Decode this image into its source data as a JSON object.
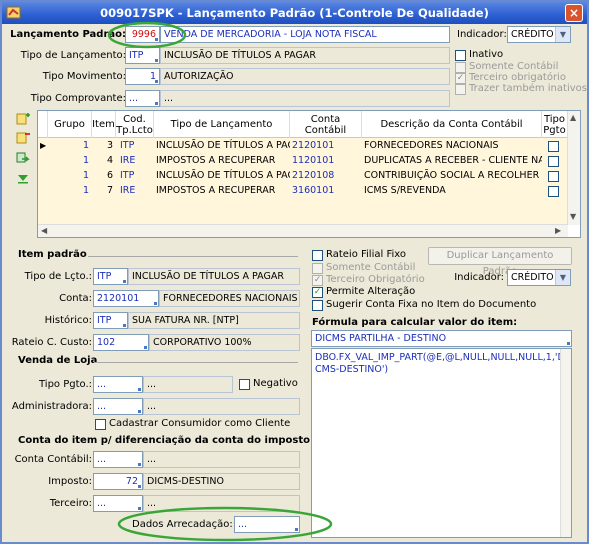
{
  "window": {
    "title": "009017SPK - Lançamento Padrão (1-Controle De Qualidade)",
    "close_glyph": "×"
  },
  "top": {
    "lancamento_padrao_label": "Lançamento Padrão:",
    "lancamento_padrao_code": "9996",
    "lancamento_padrao_desc": "VENDA DE MERCADORIA - LOJA NOTA FISCAL",
    "indicador_label": "Indicador:",
    "indicador_value": "CRÉDITO",
    "tipo_lancamento_label": "Tipo de Lançamento:",
    "tipo_lancamento_code": "ITP",
    "tipo_lancamento_desc": "INCLUSÃO DE TÍTULOS A PAGAR",
    "tipo_movimento_label": "Tipo Movimento:",
    "tipo_movimento_code": "1",
    "tipo_movimento_desc": "AUTORIZAÇÃO",
    "tipo_comprovante_label": "Tipo Comprovante:",
    "tipo_comprovante_code": "...",
    "tipo_comprovante_desc": "...",
    "inativo_label": "Inativo",
    "somente_contabil_label": "Somente Contábil",
    "terceiro_obrigatorio_label": "Terceiro obrigatório",
    "trazer_inativos_label": "Trazer também inativos"
  },
  "grid": {
    "headers": [
      "Grupo",
      "Item",
      "Cod. Tp.Lcto",
      "Tipo de Lançamento",
      "Conta Contábil",
      "Descrição da Conta Contábil",
      "Tipo Pgto"
    ],
    "rows": [
      {
        "grupo": "1",
        "item": "3",
        "cod": "ITP",
        "tipo": "INCLUSÃO DE TÍTULOS A PAGAR",
        "conta": "2120101",
        "desc": "FORNECEDORES NACIONAIS"
      },
      {
        "grupo": "1",
        "item": "4",
        "cod": "IRE",
        "tipo": "IMPOSTOS A RECUPERAR",
        "conta": "1120101",
        "desc": "DUPLICATAS A RECEBER - CLIENTE NACIONAL"
      },
      {
        "grupo": "1",
        "item": "6",
        "cod": "ITP",
        "tipo": "INCLUSÃO DE TÍTULOS A PAGAR",
        "conta": "2120108",
        "desc": "CONTRIBUIÇÃO SOCIAL A RECOLHER"
      },
      {
        "grupo": "1",
        "item": "7",
        "cod": "IRE",
        "tipo": "IMPOSTOS A RECUPERAR",
        "conta": "3160101",
        "desc": "ICMS S/REVENDA"
      }
    ]
  },
  "item_padrao": {
    "header": "Item padrão",
    "tipo_lcto_label": "Tipo de Lçto.:",
    "tipo_lcto_code": "ITP",
    "tipo_lcto_desc": "INCLUSÃO DE TÍTULOS A PAGAR",
    "conta_label": "Conta:",
    "conta_code": "2120101",
    "conta_desc": "FORNECEDORES NACIONAIS",
    "historico_label": "Histórico:",
    "historico_code": "ITP",
    "historico_desc": "SUA FATURA NR. [NTP]",
    "rateio_label": "Rateio C. Custo:",
    "rateio_code": "102",
    "rateio_desc": "CORPORATIVO 100%"
  },
  "venda_loja": {
    "header": "Venda de Loja",
    "tipo_pgto_label": "Tipo Pgto.:",
    "tipo_pgto_code": "...",
    "tipo_pgto_desc": "...",
    "negativo_label": "Negativo",
    "administradora_label": "Administradora:",
    "administradora_code": "...",
    "administradora_desc": "...",
    "cadastrar_label": "Cadastrar Consumidor como Cliente"
  },
  "conta_item": {
    "header": "Conta do item p/ diferenciação da conta do imposto",
    "conta_contabil_label": "Conta Contábil:",
    "conta_contabil_code": "...",
    "conta_contabil_desc": "...",
    "imposto_label": "Imposto:",
    "imposto_code": "72",
    "imposto_desc": "DICMS-DESTINO",
    "terceiro_label": "Terceiro:",
    "terceiro_code": "...",
    "terceiro_desc": "...",
    "dados_arrecadacao_label": "Dados Arrecadação:",
    "dados_arrecadacao_value": "..."
  },
  "right": {
    "rateio_filial_label": "Rateio Filial Fixo",
    "duplicar_label": "Duplicar Lançamento Padrão",
    "somente_contabil_label": "Somente Contábil",
    "terceiro_obrigatorio_label": "Terceiro Obrigatório",
    "permite_alteracao_label": "Permite Alteração",
    "sugerir_label": "Sugerir Conta Fixa no Item do Documento",
    "indicador_label": "Indicador:",
    "indicador_value": "CRÉDITO",
    "formula_label": "Fórmula para calcular valor do item:",
    "formula_name": "DICMS PARTILHA - DESTINO",
    "formula_text": "DBO.FX_VAL_IMP_PART(@E,@L,NULL,NULL,NULL,1,'DICMS-DESTINO')"
  },
  "colors": {
    "title_bar": "#2c5fd2",
    "value_text": "#1b2fb8",
    "code_red": "#d01010",
    "grid_row_bg": "#fff6dc",
    "highlight_ellipse": "#3aa63a"
  }
}
